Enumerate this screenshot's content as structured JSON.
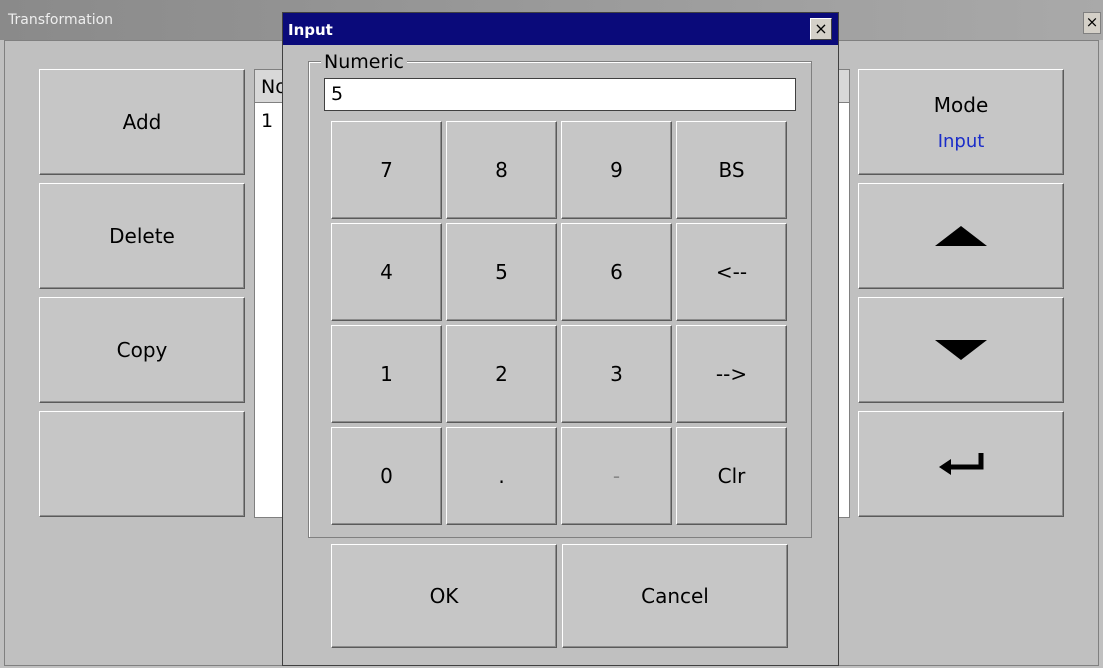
{
  "window": {
    "title": "Transformation",
    "close": "×"
  },
  "left_buttons": [
    "Add",
    "Delete",
    "Copy",
    ""
  ],
  "list": {
    "header": "No",
    "rows": [
      "1"
    ]
  },
  "right_panel": {
    "mode_label": "Mode",
    "mode_value": "Input",
    "mode_value_color": "#1a2cc9",
    "up_icon": "triangle-up",
    "down_icon": "triangle-down",
    "enter_icon": "enter-arrow"
  },
  "dialog": {
    "title": "Input",
    "close": "×",
    "group_label": "Numeric",
    "value": "5",
    "keys": [
      [
        "7",
        "8",
        "9",
        "BS"
      ],
      [
        "4",
        "5",
        "6",
        "<--"
      ],
      [
        "1",
        "2",
        "3",
        "-->"
      ],
      [
        "0",
        ".",
        "-",
        "Clr"
      ]
    ],
    "ok": "OK",
    "cancel": "Cancel",
    "title_color": "#0a0a7a"
  }
}
